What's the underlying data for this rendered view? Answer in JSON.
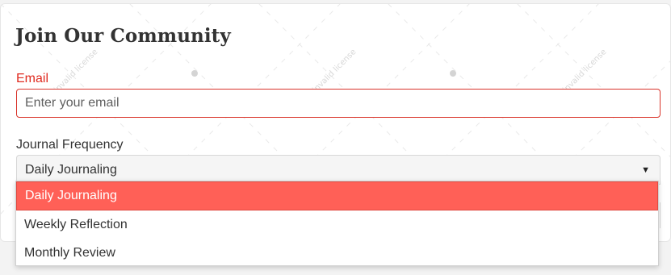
{
  "form": {
    "title": "Join Our Community",
    "email": {
      "label": "Email",
      "placeholder": "Enter your email",
      "value": ""
    },
    "frequency": {
      "label": "Journal Frequency",
      "selected": "Daily Journaling",
      "options": [
        {
          "label": "Daily Journaling",
          "selected": true
        },
        {
          "label": "Weekly Reflection",
          "selected": false
        },
        {
          "label": "Monthly Review",
          "selected": false
        }
      ]
    }
  },
  "watermark": {
    "text": "invalid license"
  },
  "icons": {
    "select_caret": "caret-down-icon"
  },
  "colors": {
    "error": "#e02b20",
    "highlight": "#ff6057",
    "text": "#333333"
  }
}
